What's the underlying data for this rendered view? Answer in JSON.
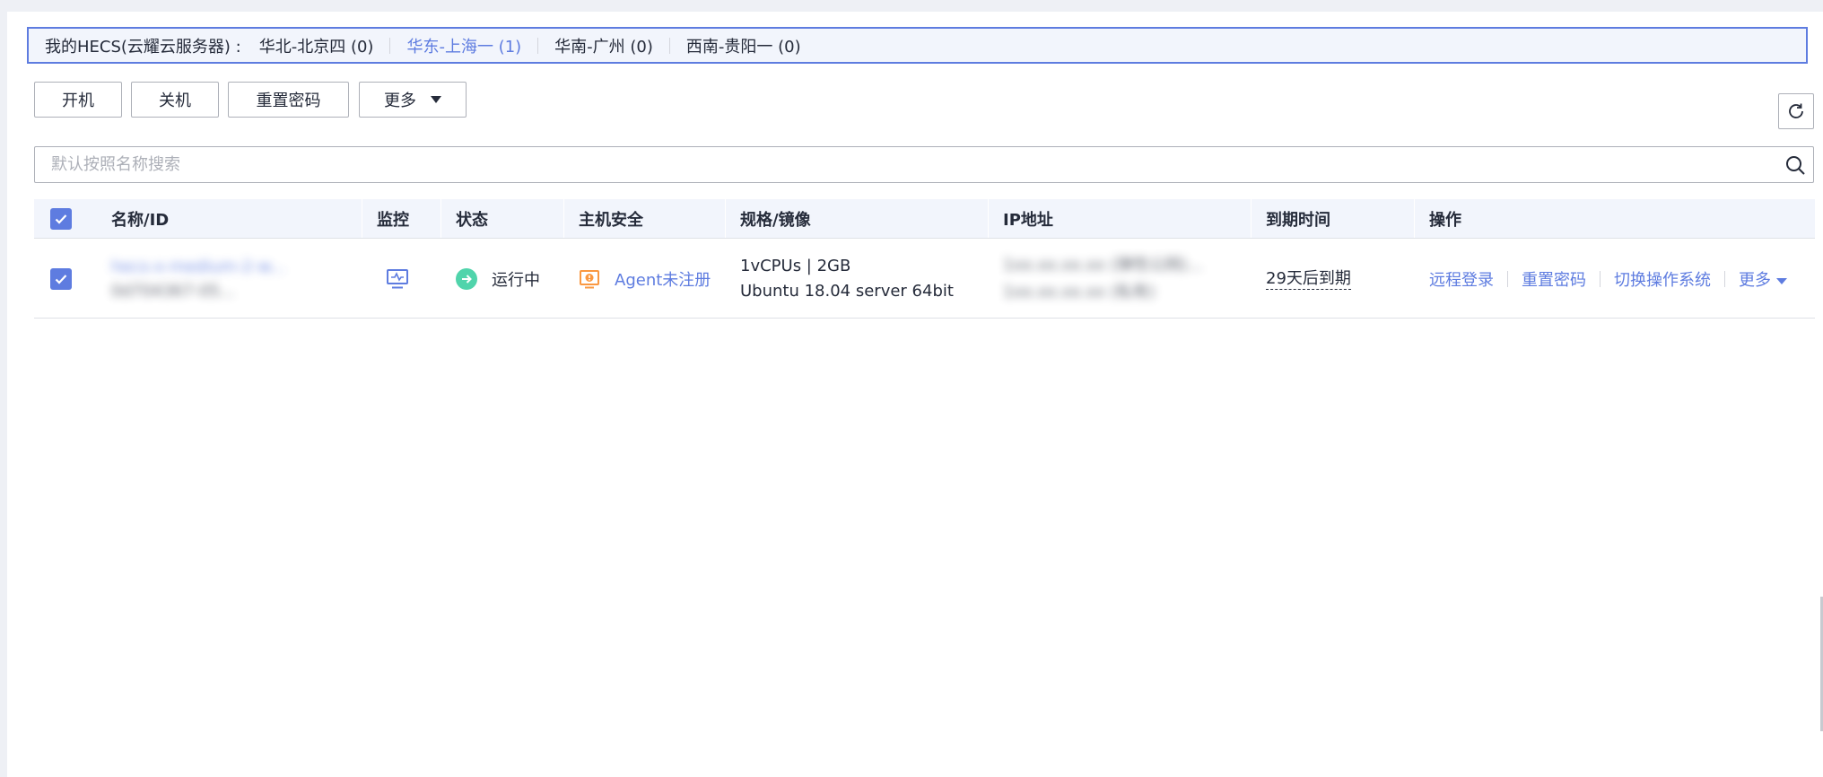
{
  "region_bar": {
    "label": "我的HECS(云耀云服务器) :",
    "regions": [
      {
        "name": "华北-北京四 (0)",
        "active": false
      },
      {
        "name": "华东-上海一 (1)",
        "active": true
      },
      {
        "name": "华南-广州 (0)",
        "active": false
      },
      {
        "name": "西南-贵阳一 (0)",
        "active": false
      }
    ]
  },
  "toolbar": {
    "power_on": "开机",
    "power_off": "关机",
    "reset_password": "重置密码",
    "more": "更多"
  },
  "search": {
    "placeholder": "默认按照名称搜索"
  },
  "table": {
    "columns": [
      "名称/ID",
      "监控",
      "状态",
      "主机安全",
      "规格/镜像",
      "IP地址",
      "到期时间",
      "操作"
    ],
    "rows": [
      {
        "name": "hecs-x-medium-2-w...",
        "id": "0d704367-05...",
        "status": "运行中",
        "security": "Agent未注册",
        "spec": "1vCPUs | 2GB",
        "image": "Ubuntu 18.04 server 64bit",
        "ip_line1": "1xx.xx.xx.xx (弹性公网)...",
        "ip_line2": "1xx.xx.xx.xx (私有)",
        "expire": "29天后到期",
        "actions": {
          "remote_login": "远程登录",
          "reset_password": "重置密码",
          "switch_os": "切换操作系统",
          "more": "更多"
        }
      }
    ]
  },
  "colors": {
    "accent": "#5e7ce0",
    "running": "#50d4ab",
    "warning": "#fa9841"
  }
}
